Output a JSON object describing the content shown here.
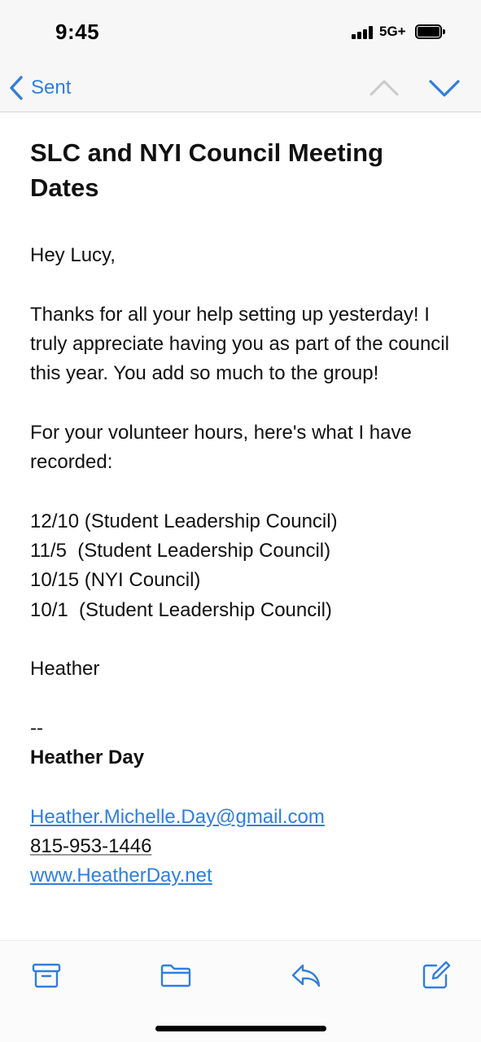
{
  "status_bar": {
    "time": "9:45",
    "network": "5G+",
    "icons": [
      "signal-bars-icon",
      "battery-icon"
    ]
  },
  "nav": {
    "back_label": "Sent",
    "icons": [
      "chevron-left-icon",
      "chevron-up-icon",
      "chevron-down-icon"
    ],
    "accent_color": "#2f7ee0",
    "up_disabled": true
  },
  "email": {
    "subject": "SLC and NYI Council Meeting Dates",
    "greeting": "Hey Lucy,",
    "paragraph1": "Thanks for all your help setting up yesterday!  I truly appreciate having you as part of the council this year.  You add so much to the group!",
    "paragraph2": "For your volunteer hours, here's what I have recorded:",
    "dates": [
      "12/10 (Student Leadership Council)",
      "11/5  (Student Leadership Council)",
      "10/15 (NYI Council)",
      "10/1  (Student Leadership Council)"
    ],
    "signoff": "Heather",
    "signature_separator": "--",
    "signature_name": "Heather Day",
    "email_link": "Heather.Michelle.Day@gmail.com",
    "phone": "815-953-1446",
    "website": "www.HeatherDay.net"
  },
  "toolbar": {
    "icons": [
      "archive-icon",
      "folder-icon",
      "reply-icon",
      "compose-icon"
    ]
  }
}
